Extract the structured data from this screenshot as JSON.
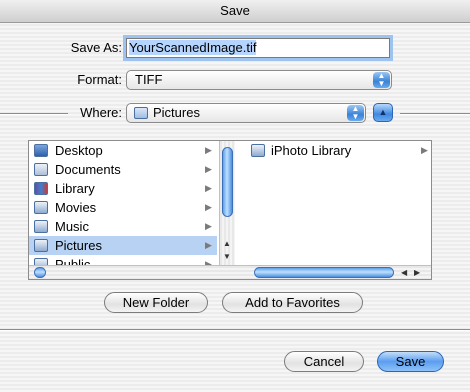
{
  "window": {
    "title": "Save"
  },
  "save_as": {
    "label": "Save As:",
    "value": "YourScannedImage.tif"
  },
  "format": {
    "label": "Format:",
    "selected": "TIFF"
  },
  "where": {
    "label": "Where:",
    "selected": "Pictures"
  },
  "sidebar_items": [
    {
      "label": "Desktop",
      "icon": "desktop-icon"
    },
    {
      "label": "Documents",
      "icon": "documents-folder-icon"
    },
    {
      "label": "Library",
      "icon": "library-folder-icon"
    },
    {
      "label": "Movies",
      "icon": "movies-folder-icon"
    },
    {
      "label": "Music",
      "icon": "music-folder-icon"
    },
    {
      "label": "Pictures",
      "icon": "pictures-folder-icon",
      "selected": true
    },
    {
      "label": "Public",
      "icon": "public-folder-icon"
    }
  ],
  "column2_items": [
    {
      "label": "iPhoto Library",
      "icon": "folder-icon"
    }
  ],
  "buttons": {
    "new_folder": "New Folder",
    "add_to_favorites": "Add to Favorites",
    "cancel": "Cancel",
    "save": "Save"
  },
  "colors": {
    "accent": "#3f88e0",
    "selection": "#b7d2f3"
  }
}
